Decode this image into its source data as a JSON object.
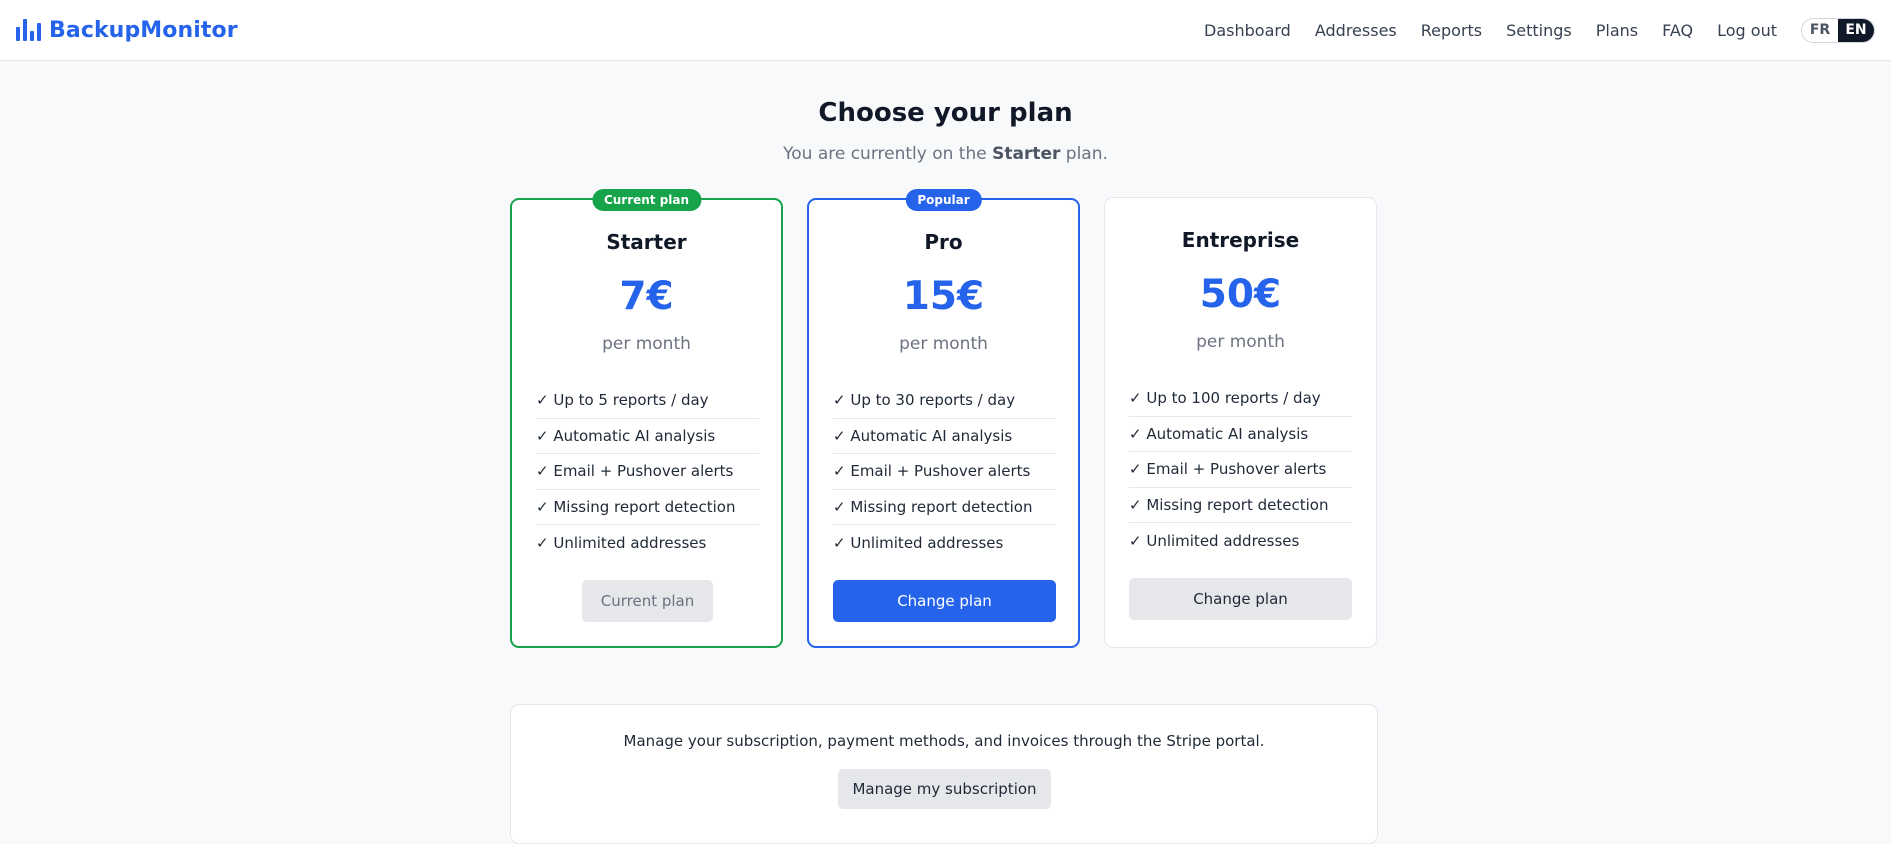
{
  "brand": {
    "name": "BackupMonitor",
    "icon": "bar-chart-icon",
    "color": "#2563eb"
  },
  "nav": {
    "links": [
      "Dashboard",
      "Addresses",
      "Reports",
      "Settings",
      "Plans",
      "FAQ",
      "Log out"
    ],
    "languages": {
      "fr": "FR",
      "en": "EN",
      "active": "EN"
    }
  },
  "page": {
    "title": "Choose your plan",
    "subtitle_prefix": "You are currently on the ",
    "current_plan_name": "Starter",
    "subtitle_suffix": " plan."
  },
  "plans": [
    {
      "name": "Starter",
      "price": "7€",
      "period": "per month",
      "badge": "Current plan",
      "features": [
        "✓ Up to 5 reports / day",
        "✓ Automatic AI analysis",
        "✓ Email + Pushover alerts",
        "✓ Missing report detection",
        "✓ Unlimited addresses"
      ],
      "button": "Current plan"
    },
    {
      "name": "Pro",
      "price": "15€",
      "period": "per month",
      "badge": "Popular",
      "features": [
        "✓ Up to 30 reports / day",
        "✓ Automatic AI analysis",
        "✓ Email + Pushover alerts",
        "✓ Missing report detection",
        "✓ Unlimited addresses"
      ],
      "button": "Change plan"
    },
    {
      "name": "Entreprise",
      "price": "50€",
      "period": "per month",
      "features": [
        "✓ Up to 100 reports / day",
        "✓ Automatic AI analysis",
        "✓ Email + Pushover alerts",
        "✓ Missing report detection",
        "✓ Unlimited addresses"
      ],
      "button": "Change plan"
    }
  ],
  "manage": {
    "text": "Manage your subscription, payment methods, and invoices through the Stripe portal.",
    "button": "Manage my subscription"
  },
  "colors": {
    "accent": "#2563eb",
    "current": "#16a34a",
    "background": "#f8f9fb"
  }
}
